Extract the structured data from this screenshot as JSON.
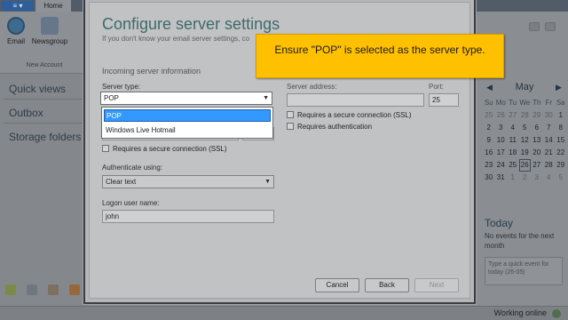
{
  "app": {
    "menu_label": "≡ ▾",
    "tab_home": "Home",
    "ribbon": {
      "email_label": "Email",
      "newsgroup_label": "Newsgroup",
      "group_label": "New Account"
    },
    "nav": [
      "Quick views",
      "Outbox",
      "Storage folders"
    ],
    "status": "Working online"
  },
  "calendar": {
    "month": "May",
    "prev": "◀",
    "next": "▶",
    "weekdays": [
      "Su",
      "Mo",
      "Tu",
      "We",
      "Th",
      "Fr",
      "Sa"
    ],
    "weeks": [
      [
        "25",
        "26",
        "27",
        "28",
        "29",
        "30",
        "1"
      ],
      [
        "2",
        "3",
        "4",
        "5",
        "6",
        "7",
        "8"
      ],
      [
        "9",
        "10",
        "11",
        "12",
        "13",
        "14",
        "15"
      ],
      [
        "16",
        "17",
        "18",
        "19",
        "20",
        "21",
        "22"
      ],
      [
        "23",
        "24",
        "25",
        "26",
        "27",
        "28",
        "29"
      ],
      [
        "30",
        "31",
        "1",
        "2",
        "3",
        "4",
        "5"
      ]
    ],
    "today_title": "Today",
    "today_note": "No events for the next month",
    "quick_event_placeholder": "Type a quick event for today (26-05)"
  },
  "dialog": {
    "title": "Configure server settings",
    "subtitle": "If you don't know your email server settings, co",
    "section_incoming": "Incoming server information",
    "server_type_label": "Server type:",
    "server_type_value": "POP",
    "server_type_options": [
      "POP",
      "Windows Live Hotmail"
    ],
    "server_address_label": "Server address:",
    "port_label": "Port:",
    "port_value": "25",
    "secure_left": "Requires a secure connection (SSL)",
    "secure_right": "Requires a secure connection (SSL)",
    "requires_auth": "Requires authentication",
    "auth_label": "Authenticate using:",
    "auth_value": "Clear text",
    "logon_label": "Logon user name:",
    "logon_value": "john",
    "buttons": {
      "cancel": "Cancel",
      "back": "Back",
      "next": "Next"
    }
  },
  "callout": {
    "text": "Ensure \"POP\" is selected as the server type."
  },
  "colors": {
    "callout_bg": "#ffc000",
    "selection": "#3399ff",
    "dialog_title": "#3f6a6a"
  }
}
